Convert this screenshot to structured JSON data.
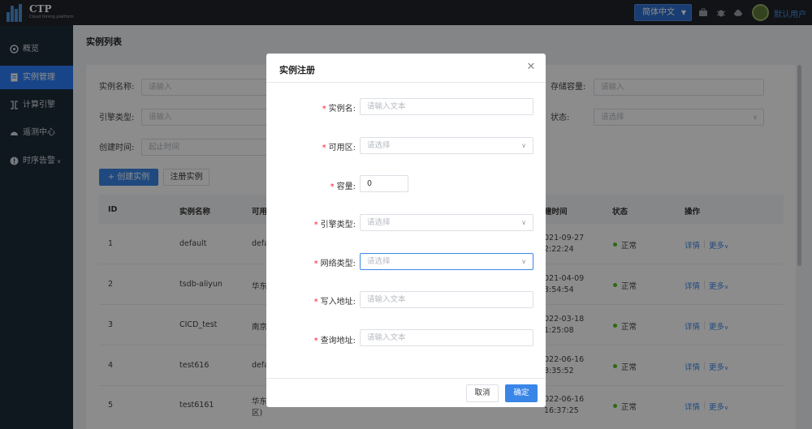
{
  "header": {
    "logo_title": "CTP",
    "logo_subtitle": "Cloud timing platform",
    "lang_label": "简体中文",
    "user_name": "默认用户"
  },
  "sidebar": {
    "items": [
      {
        "label": "概览",
        "icon": "dashboard-icon"
      },
      {
        "label": "实例管理",
        "icon": "document-icon"
      },
      {
        "label": "计算引擎",
        "icon": "engine-icon"
      },
      {
        "label": "遥测中心",
        "icon": "gauge-icon"
      },
      {
        "label": "时序告警",
        "icon": "alert-icon"
      }
    ],
    "active_index": 1
  },
  "page": {
    "title": "实例列表"
  },
  "filters": {
    "name_label": "实例名称:",
    "name_placeholder": "请输入",
    "storage_label": "存储容量:",
    "storage_placeholder": "请输入",
    "engine_label": "引擎类型:",
    "engine_placeholder": "请输入",
    "status_label": "状态:",
    "status_placeholder": "请选择",
    "time_label": "创建时间:",
    "time_placeholder": "起止时间"
  },
  "actions": {
    "create_label": "+ 创建实例",
    "register_label": "注册实例"
  },
  "table": {
    "columns": [
      "ID",
      "实例名称",
      "可用",
      "建时间",
      "状态",
      "操作"
    ],
    "rows": [
      {
        "id": "1",
        "name": "default",
        "zone": "defa",
        "time1": "021-09-27",
        "time2": "2:22:24",
        "status": "正常"
      },
      {
        "id": "2",
        "name": "tsdb-aliyun",
        "zone": "华东",
        "time1": "021-04-09",
        "time2": "3:54:54",
        "status": "正常"
      },
      {
        "id": "3",
        "name": "CICD_test",
        "zone": "南京",
        "time1": "022-03-18",
        "time2": "1:25:08",
        "status": "正常"
      },
      {
        "id": "4",
        "name": "test616",
        "zone": "defa",
        "time1": "022-06-16",
        "time2": "3:35:52",
        "status": "正常"
      },
      {
        "id": "5",
        "name": "test6161",
        "zone": "华东",
        "zone2": "区)",
        "time1": "022-06-16",
        "time2": "16:37:25",
        "status": "正常"
      }
    ],
    "detail_link": "详情",
    "more_link": "更多"
  },
  "dialog": {
    "title": "实例注册",
    "fields": [
      {
        "label": "实例名:",
        "placeholder": "请输入文本",
        "type": "text"
      },
      {
        "label": "可用区:",
        "placeholder": "请选择",
        "type": "select"
      },
      {
        "label": "容量:",
        "value": "0",
        "type": "number"
      },
      {
        "label": "引擎类型:",
        "placeholder": "请选择",
        "type": "select"
      },
      {
        "label": "网络类型:",
        "placeholder": "请选择",
        "type": "select"
      },
      {
        "label": "写入地址:",
        "placeholder": "请输入文本",
        "type": "text"
      },
      {
        "label": "查询地址:",
        "placeholder": "请输入文本",
        "type": "text"
      }
    ],
    "cancel_label": "取消",
    "ok_label": "确定"
  },
  "colors": {
    "topbar": "#1f2329",
    "sidebar": "#1c2b3a",
    "primary": "#3a86e8",
    "status_ok": "#52c41a"
  }
}
